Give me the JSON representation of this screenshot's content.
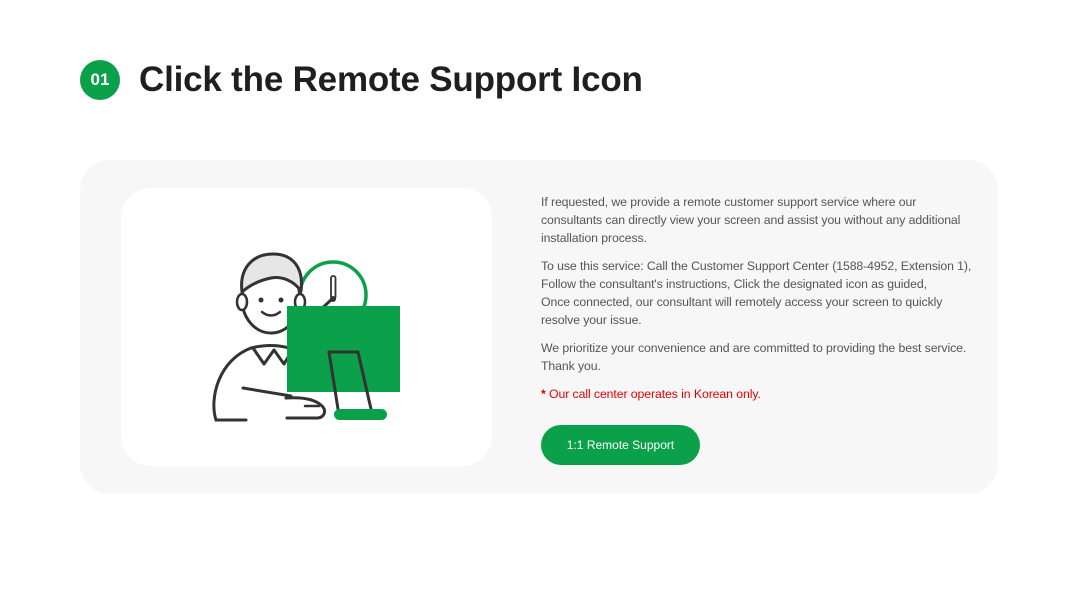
{
  "step": {
    "number": "01",
    "title": "Click the Remote Support Icon"
  },
  "description": {
    "paragraph1": "If requested, we provide a remote customer support service where our consultants can directly view your screen and assist you without any additional installation process.",
    "paragraph2_lines": [
      "To use this service: Call the Customer Support Center (1588-4952, Extension 1),",
      "Follow the consultant's instructions, Click the designated icon as guided,",
      "Once connected, our consultant will remotely access your screen to quickly resolve your issue."
    ],
    "paragraph3_lines": [
      "We prioritize your convenience and are committed to providing the best service.",
      "Thank you."
    ],
    "notice_mark": "*",
    "notice_text": "Our call center operates in Korean only."
  },
  "button": {
    "label": "1:1 Remote Support"
  },
  "illustration": {
    "icon": "consultant-at-computer-icon",
    "accent_color": "#0ba14b",
    "line_color": "#333333"
  },
  "colors": {
    "brand_green": "#0ba14b",
    "notice_red": "#e60000",
    "card_bg": "#f7f7f7"
  }
}
